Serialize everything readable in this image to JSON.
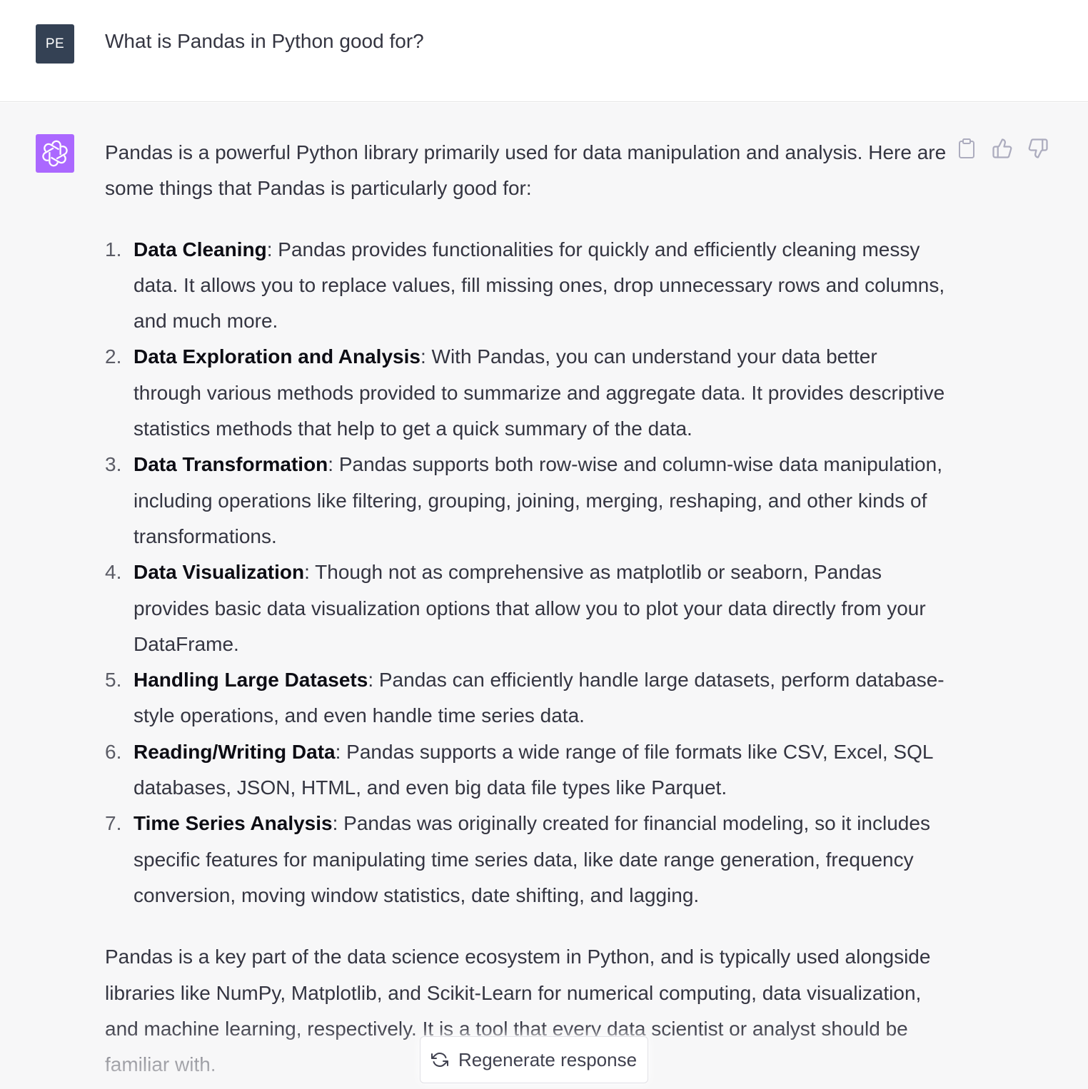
{
  "user": {
    "avatar_initials": "PE",
    "message": "What is Pandas in Python good for?"
  },
  "assistant": {
    "avatar_icon": "openai-logo-icon",
    "intro": "Pandas is a powerful Python library primarily used for data manipulation and analysis. Here are some things that Pandas is particularly good for:",
    "items": [
      {
        "number": "1.",
        "title": "Data Cleaning",
        "text": ": Pandas provides functionalities for quickly and efficiently cleaning messy data. It allows you to replace values, fill missing ones, drop unnecessary rows and columns, and much more."
      },
      {
        "number": "2.",
        "title": "Data Exploration and Analysis",
        "text": ": With Pandas, you can understand your data better through various methods provided to summarize and aggregate data. It provides descriptive statistics methods that help to get a quick summary of the data."
      },
      {
        "number": "3.",
        "title": "Data Transformation",
        "text": ": Pandas supports both row-wise and column-wise data manipulation, including operations like filtering, grouping, joining, merging, reshaping, and other kinds of transformations."
      },
      {
        "number": "4.",
        "title": "Data Visualization",
        "text": ": Though not as comprehensive as matplotlib or seaborn, Pandas provides basic data visualization options that allow you to plot your data directly from your DataFrame."
      },
      {
        "number": "5.",
        "title": "Handling Large Datasets",
        "text": ": Pandas can efficiently handle large datasets, perform database-style operations, and even handle time series data."
      },
      {
        "number": "6.",
        "title": "Reading/Writing Data",
        "text": ": Pandas supports a wide range of file formats like CSV, Excel, SQL databases, JSON, HTML, and even big data file types like Parquet."
      },
      {
        "number": "7.",
        "title": "Time Series Analysis",
        "text": ": Pandas was originally created for financial modeling, so it includes specific features for manipulating time series data, like date range generation, frequency conversion, moving window statistics, date shifting, and lagging."
      }
    ],
    "outro": "Pandas is a key part of the data science ecosystem in Python, and is typically used alongside libraries like NumPy, Matplotlib, and Scikit-Learn for numerical computing, data visualization, and machine learning, respectively. It is a tool that every data scientist or analyst should be familiar with."
  },
  "actions": {
    "copy_icon": "clipboard-icon",
    "like_icon": "thumbs-up-icon",
    "dislike_icon": "thumbs-down-icon"
  },
  "regenerate": {
    "icon": "refresh-icon",
    "label": "Regenerate response"
  },
  "colors": {
    "user_avatar_bg": "#344154",
    "assistant_avatar_bg": "#ab68ff",
    "assistant_row_bg": "#f7f7f8",
    "text": "#343541"
  }
}
